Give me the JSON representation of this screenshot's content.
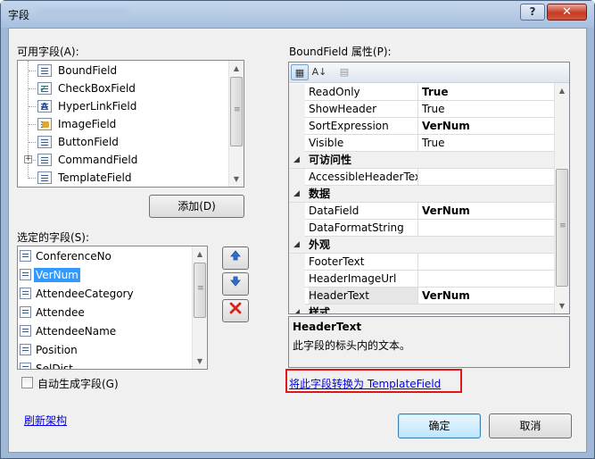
{
  "window": {
    "title": "字段",
    "help_label": "?",
    "close_label": "✕"
  },
  "available": {
    "label": "可用字段(A):",
    "items": [
      {
        "label": "BoundField",
        "icon": "bound-field-icon"
      },
      {
        "label": "CheckBoxField",
        "icon": "checkbox-field-icon"
      },
      {
        "label": "HyperLinkField",
        "icon": "hyperlink-field-icon"
      },
      {
        "label": "ImageField",
        "icon": "image-field-icon"
      },
      {
        "label": "ButtonField",
        "icon": "button-field-icon"
      },
      {
        "label": "CommandField",
        "icon": "command-field-icon",
        "expander": "+"
      },
      {
        "label": "TemplateField",
        "icon": "template-field-icon"
      }
    ],
    "add_button": "添加(D)"
  },
  "selected": {
    "label": "选定的字段(S):",
    "items": [
      {
        "label": "ConferenceNo"
      },
      {
        "label": "VerNum",
        "selected": true
      },
      {
        "label": "AttendeeCategory"
      },
      {
        "label": "Attendee"
      },
      {
        "label": "AttendeeName"
      },
      {
        "label": "Position"
      },
      {
        "label": "SelDist"
      }
    ],
    "move_up_icon": "arrow-up-icon",
    "move_down_icon": "arrow-down-icon",
    "delete_icon": "delete-x-icon"
  },
  "auto_generate": {
    "label": "自动生成字段(G)",
    "checked": false
  },
  "refresh_link": "刷新架构",
  "properties": {
    "label": "BoundField 属性(P):",
    "toolbar": [
      "categorized-icon",
      "alphabetical-icon",
      "property-pages-icon"
    ],
    "rows": [
      {
        "type": "prop",
        "name": "ReadOnly",
        "value": "True",
        "bold": true
      },
      {
        "type": "prop",
        "name": "ShowHeader",
        "value": "True",
        "bold": false
      },
      {
        "type": "prop",
        "name": "SortExpression",
        "value": "VerNum",
        "bold": true
      },
      {
        "type": "prop",
        "name": "Visible",
        "value": "True",
        "bold": false
      },
      {
        "type": "cat",
        "name": "可访问性"
      },
      {
        "type": "prop",
        "name": "AccessibleHeaderText",
        "value": "",
        "bold": false
      },
      {
        "type": "cat",
        "name": "数据"
      },
      {
        "type": "prop",
        "name": "DataField",
        "value": "VerNum",
        "bold": true
      },
      {
        "type": "prop",
        "name": "DataFormatString",
        "value": "",
        "bold": false
      },
      {
        "type": "cat",
        "name": "外观"
      },
      {
        "type": "prop",
        "name": "FooterText",
        "value": "",
        "bold": false
      },
      {
        "type": "prop",
        "name": "HeaderImageUrl",
        "value": "",
        "bold": false
      },
      {
        "type": "prop",
        "name": "HeaderText",
        "value": "VerNum",
        "bold": true,
        "selected": true
      },
      {
        "type": "cat",
        "name": "样式"
      }
    ],
    "description_title": "HeaderText",
    "description_text": "此字段的标头内的文本。"
  },
  "convert_link": "将此字段转换为 TemplateField",
  "ok_button": "确定",
  "cancel_button": "取消"
}
